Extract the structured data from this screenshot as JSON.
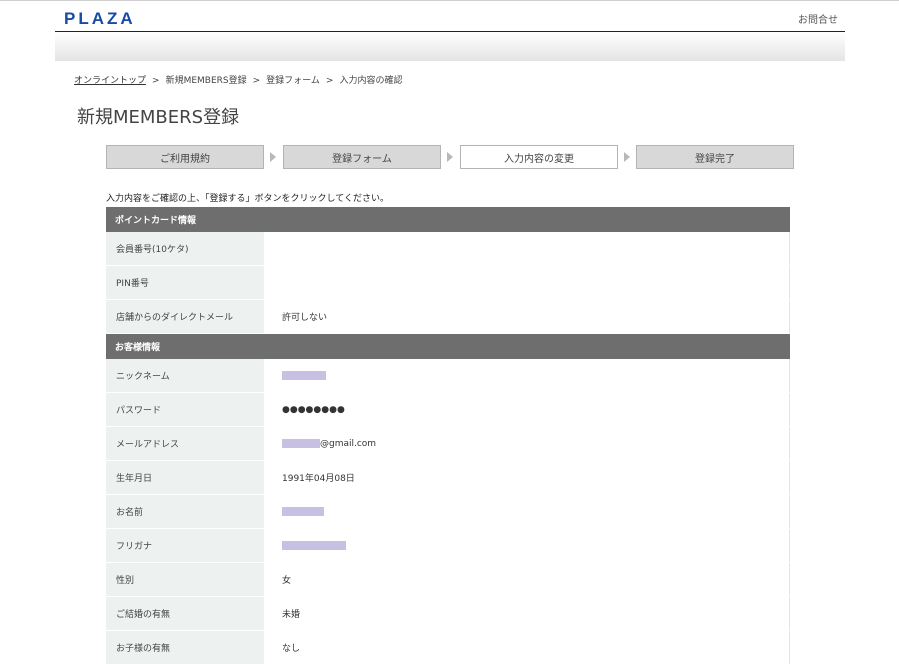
{
  "header": {
    "logo": "PLAZA",
    "contact_link": "お問合せ"
  },
  "breadcrumb": {
    "items": [
      "オンライントップ",
      "新規MEMBERS登録",
      "登録フォーム",
      "入力内容の確認"
    ],
    "separator": ">"
  },
  "page_title": "新規MEMBERS登録",
  "steps": [
    {
      "label": "ご利用規約",
      "active": false
    },
    {
      "label": "登録フォーム",
      "active": false
    },
    {
      "label": "入力内容の変更",
      "active": true
    },
    {
      "label": "登録完了",
      "active": false
    }
  ],
  "instruction": "入力内容をご確認の上、「登録する」ボタンをクリックしてください。",
  "sections": [
    {
      "title": "ポイントカード情報",
      "rows": [
        {
          "label": "会員番号(10ケタ)",
          "value": ""
        },
        {
          "label": "PIN番号",
          "value": ""
        },
        {
          "label": "店舗からのダイレクトメール",
          "value": "許可しない"
        }
      ]
    },
    {
      "title": "お客様情報",
      "rows": [
        {
          "label": "ニックネーム",
          "value": ""
        },
        {
          "label": "パスワード",
          "value": "●●●●●●●●"
        },
        {
          "label": "メールアドレス",
          "value": "@gmail.com"
        },
        {
          "label": "生年月日",
          "value": "1991年04月08日"
        },
        {
          "label": "お名前",
          "value": ""
        },
        {
          "label": "フリガナ",
          "value": ""
        },
        {
          "label": "性別",
          "value": "女"
        },
        {
          "label": "ご結婚の有無",
          "value": "未婚"
        },
        {
          "label": "お子様の有無",
          "value": "なし"
        }
      ]
    }
  ],
  "colors": {
    "logo": "#1a4aa8",
    "section_header_bg": "#6e6e6e",
    "label_bg": "#edf1f0",
    "redaction": "#c8c0e2"
  }
}
